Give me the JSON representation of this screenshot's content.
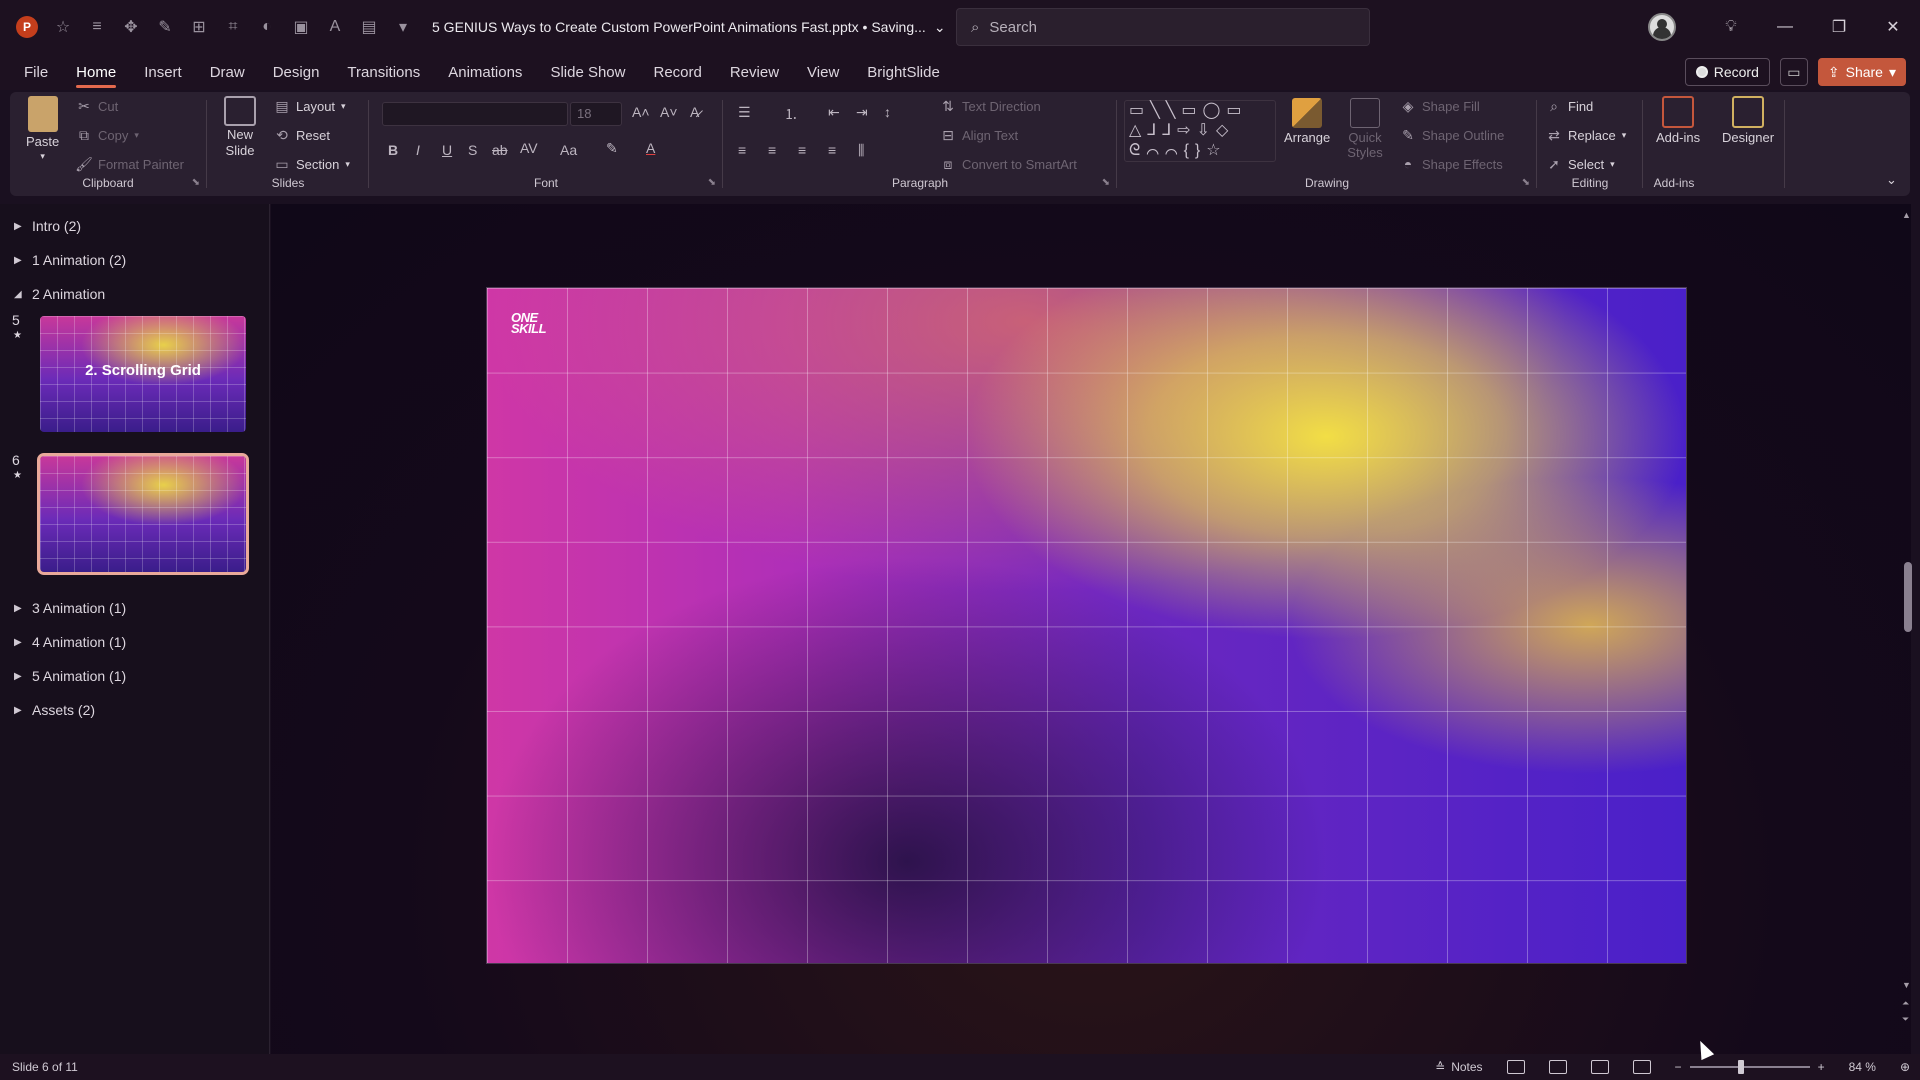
{
  "titlebar": {
    "app_icon_letter": "P",
    "doc_title": "5 GENIUS Ways to Create Custom PowerPoint Animations Fast.pptx • Saving...",
    "search_placeholder": "Search"
  },
  "menu": {
    "tabs": [
      "File",
      "Home",
      "Insert",
      "Draw",
      "Design",
      "Transitions",
      "Animations",
      "Slide Show",
      "Record",
      "Review",
      "View",
      "BrightSlide"
    ],
    "active_tab": "Home",
    "record_label": "Record",
    "share_label": "Share"
  },
  "ribbon": {
    "clipboard": {
      "paste": "Paste",
      "cut": "Cut",
      "copy": "Copy",
      "format_painter": "Format Painter",
      "label": "Clipboard"
    },
    "slides": {
      "new_slide": "New Slide",
      "layout": "Layout",
      "reset": "Reset",
      "section": "Section",
      "label": "Slides"
    },
    "font": {
      "font_name": "",
      "font_size": "18",
      "label": "Font"
    },
    "paragraph": {
      "text_direction": "Text Direction",
      "align_text": "Align Text",
      "convert_smartart": "Convert to SmartArt",
      "label": "Paragraph"
    },
    "drawing": {
      "arrange": "Arrange",
      "quick_styles": "Quick Styles",
      "shape_fill": "Shape Fill",
      "shape_outline": "Shape Outline",
      "shape_effects": "Shape Effects",
      "label": "Drawing"
    },
    "editing": {
      "find": "Find",
      "replace": "Replace",
      "select": "Select",
      "label": "Editing"
    },
    "addins": {
      "addins": "Add-ins",
      "designer": "Designer",
      "label": "Add-ins"
    }
  },
  "sections": {
    "intro": "Intro (2)",
    "anim1": "1 Animation (2)",
    "anim2": "2 Animation",
    "anim3": "3 Animation (1)",
    "anim4": "4 Animation (1)",
    "anim5": "5 Animation (1)",
    "assets": "Assets (2)"
  },
  "slides": [
    {
      "number": "5",
      "title": "2. Scrolling Grid"
    },
    {
      "number": "6",
      "title": ""
    }
  ],
  "slide_logo": {
    "line1": "ONE",
    "line2": "SKILL"
  },
  "status": {
    "slide_info": "Slide 6 of 11",
    "notes": "Notes",
    "zoom": "84 %"
  },
  "colors": {
    "accent": "#c4573c",
    "tab_underline": "#e46a4e",
    "selected_thumb_border": "#e9a99a"
  }
}
